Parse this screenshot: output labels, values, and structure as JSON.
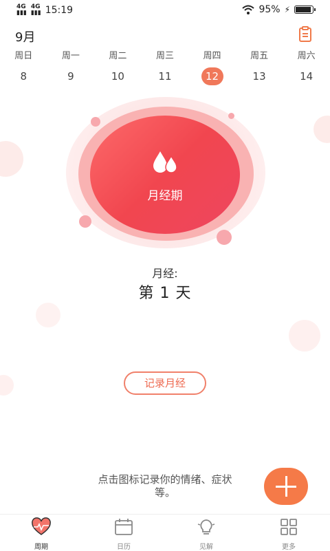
{
  "status": {
    "net1": "4G",
    "net2": "4G",
    "time": "15:19",
    "battery": "95%",
    "battery_level": 0.95
  },
  "header": {
    "month": "9月"
  },
  "week": [
    {
      "name": "周日",
      "date": "8"
    },
    {
      "name": "周一",
      "date": "9"
    },
    {
      "name": "周二",
      "date": "10"
    },
    {
      "name": "周三",
      "date": "11"
    },
    {
      "name": "周四",
      "date": "12",
      "active": true
    },
    {
      "name": "周五",
      "date": "13"
    },
    {
      "name": "周六",
      "date": "14"
    }
  ],
  "cycle": {
    "phase": "月经期",
    "count_label": "月经:",
    "count_value": "第 1 天"
  },
  "actions": {
    "record_label": "记录月经"
  },
  "hint": {
    "line1": "点击图标记录你的情绪、症状",
    "line2": "等。"
  },
  "nav": [
    {
      "label": "周期",
      "icon": "heart-pulse-icon"
    },
    {
      "label": "日历",
      "icon": "calendar-icon"
    },
    {
      "label": "见解",
      "icon": "lightbulb-icon"
    },
    {
      "label": "更多",
      "icon": "grid-icon"
    }
  ],
  "colors": {
    "accent": "#f57a48",
    "period": "#f1464f"
  }
}
